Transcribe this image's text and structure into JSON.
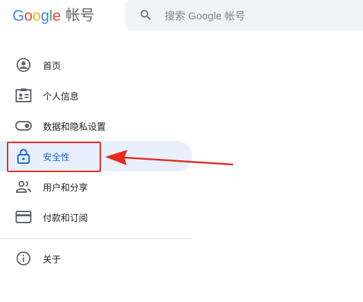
{
  "header": {
    "logo": {
      "letters": [
        "G",
        "o",
        "o",
        "g",
        "l",
        "e"
      ],
      "product": "帐号"
    },
    "search": {
      "placeholder": "搜索 Google 帐号",
      "icon": "search-icon"
    }
  },
  "sidebar": {
    "items": [
      {
        "label": "首页",
        "icon": "account-circle-icon",
        "active": false
      },
      {
        "label": "个人信息",
        "icon": "id-card-icon",
        "active": false
      },
      {
        "label": "数据和隐私设置",
        "icon": "toggle-icon",
        "active": false
      },
      {
        "label": "安全性",
        "icon": "lock-icon",
        "active": true
      },
      {
        "label": "用户和分享",
        "icon": "people-icon",
        "active": false
      },
      {
        "label": "付款和订阅",
        "icon": "credit-card-icon",
        "active": false
      }
    ],
    "secondary": [
      {
        "label": "关于",
        "icon": "info-icon",
        "active": false
      }
    ]
  },
  "colors": {
    "google_blue": "#4285F4",
    "google_red": "#EA4335",
    "google_yellow": "#FBBC05",
    "google_green": "#34A853",
    "active_bg": "#e8f0fe",
    "active_text": "#1967d2",
    "annotation_red": "#e52a1b"
  }
}
